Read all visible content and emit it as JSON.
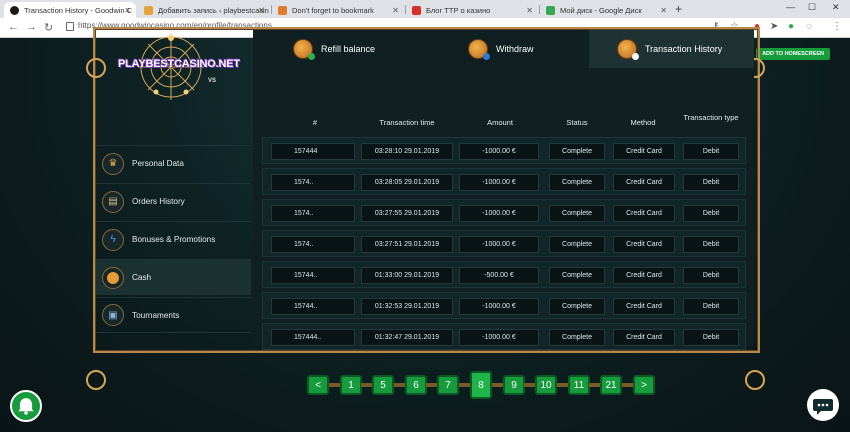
{
  "browser": {
    "tabs": [
      {
        "title": "Transaction History - Goodwin C",
        "fav_color": "#1a1a1a"
      },
      {
        "title": "Добавить запись ‹ playbestcasin",
        "fav_color": "#e5a23c"
      },
      {
        "title": "Don't forget to bookmark",
        "fav_color": "#e07a2f"
      },
      {
        "title": "Блог ТТР о казино",
        "fav_color": "#d93025"
      },
      {
        "title": "Мой диск - Google Диск",
        "fav_color": "#34a853"
      }
    ],
    "url": "https://www.goodwincasino.com/en/profile/transactions"
  },
  "header": {
    "homescreen_label": "ADD TO HOMESCREEN"
  },
  "logo": {
    "text": "PLAYBESTCASINO.NET",
    "sub": "VS"
  },
  "sidebar": {
    "items": [
      {
        "label": "Personal Data",
        "icon": "crown-icon"
      },
      {
        "label": "Orders History",
        "icon": "scroll-icon"
      },
      {
        "label": "Bonuses & Promotions",
        "icon": "lightning-icon"
      },
      {
        "label": "Cash",
        "icon": "coin-icon"
      },
      {
        "label": "Tournaments",
        "icon": "screen-icon"
      }
    ],
    "active": "Cash"
  },
  "tabs": [
    {
      "label": "Refill balance",
      "badge_color": "#2fb14b"
    },
    {
      "label": "Withdraw",
      "badge_color": "#2a7ad8"
    },
    {
      "label": "Transaction History",
      "badge_color": "#ffffff"
    }
  ],
  "table": {
    "headers": [
      "#",
      "Transaction time",
      "Amount",
      "Status",
      "Method",
      "Transaction type"
    ],
    "rows": [
      {
        "id": "157444",
        "time": "03:28:10 29.01.2019",
        "amount": "-1000.00 €",
        "status": "Complete",
        "method": "Credit Card",
        "type": "Debit"
      },
      {
        "id": "1574..",
        "time": "03:28:05 29.01.2019",
        "amount": "-1000.00 €",
        "status": "Complete",
        "method": "Credit Card",
        "type": "Debit"
      },
      {
        "id": "1574..",
        "time": "03:27:55 29.01.2019",
        "amount": "-1000.00 €",
        "status": "Complete",
        "method": "Credit Card",
        "type": "Debit"
      },
      {
        "id": "1574..",
        "time": "03:27:51 29.01.2019",
        "amount": "-1000.00 €",
        "status": "Complete",
        "method": "Credit Card",
        "type": "Debit"
      },
      {
        "id": "15744..",
        "time": "01:33:00 29.01.2019",
        "amount": "-500.00 €",
        "status": "Complete",
        "method": "Credit Card",
        "type": "Debit"
      },
      {
        "id": "15744..",
        "time": "01:32:53 29.01.2019",
        "amount": "-1000.00 €",
        "status": "Complete",
        "method": "Credit Card",
        "type": "Debit"
      },
      {
        "id": "157444..",
        "time": "01:32:47 29.01.2019",
        "amount": "-1000.00 €",
        "status": "Complete",
        "method": "Credit Card",
        "type": "Debit"
      }
    ]
  },
  "pagination": {
    "prev": "<",
    "pages": [
      "1",
      "5",
      "6",
      "7",
      "8",
      "9",
      "10",
      "11",
      "21"
    ],
    "current": "8",
    "next": ">"
  },
  "colors": {
    "accent": "#169c3c",
    "gold": "#b5894a",
    "panel": "#0f1f22"
  }
}
